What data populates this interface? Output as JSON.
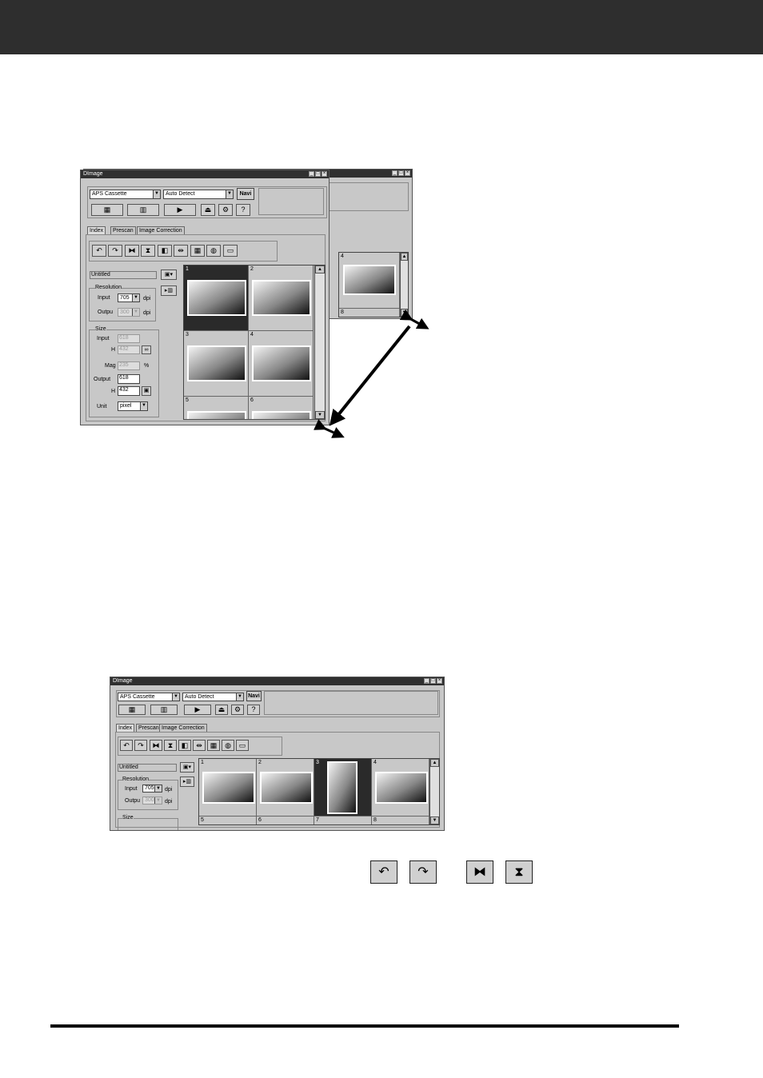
{
  "window": {
    "title": "DImage"
  },
  "selects": {
    "source": "APS Cassette",
    "mode": "Auto Detect",
    "unit": "pixel"
  },
  "buttons": {
    "navi": "Navi"
  },
  "tabs": [
    "Index",
    "Prescan",
    "Image Correction"
  ],
  "left_panel": {
    "job_name": "Untitled",
    "resolution_group": "Resolution",
    "input_label": "Input",
    "output_label": "Outpu",
    "input_dpi": "705",
    "output_dpi": "300",
    "dpi_unit": "dpi",
    "size_group": "Size",
    "size_input_label": "Input",
    "size_input_w": "618",
    "h_label": "H",
    "size_input_h": "432",
    "mag_label": "Mag",
    "mag_value": "235",
    "percent": "%",
    "size_output_label": "Output",
    "size_output_w": "618",
    "size_output_h": "432",
    "unit_label": "Unit"
  },
  "frames_top": [
    "1",
    "2",
    "3",
    "4",
    "5",
    "6"
  ],
  "frames_back": [
    "4",
    "8"
  ],
  "frames_bottom": [
    "1",
    "2",
    "3",
    "4",
    "5",
    "6",
    "7",
    "8"
  ],
  "icons": {
    "rotate_left": "rotate-left-icon",
    "rotate_right": "rotate-right-icon",
    "flip_horizontal": "flip-horizontal-icon",
    "flip_vertical": "flip-vertical-icon"
  }
}
